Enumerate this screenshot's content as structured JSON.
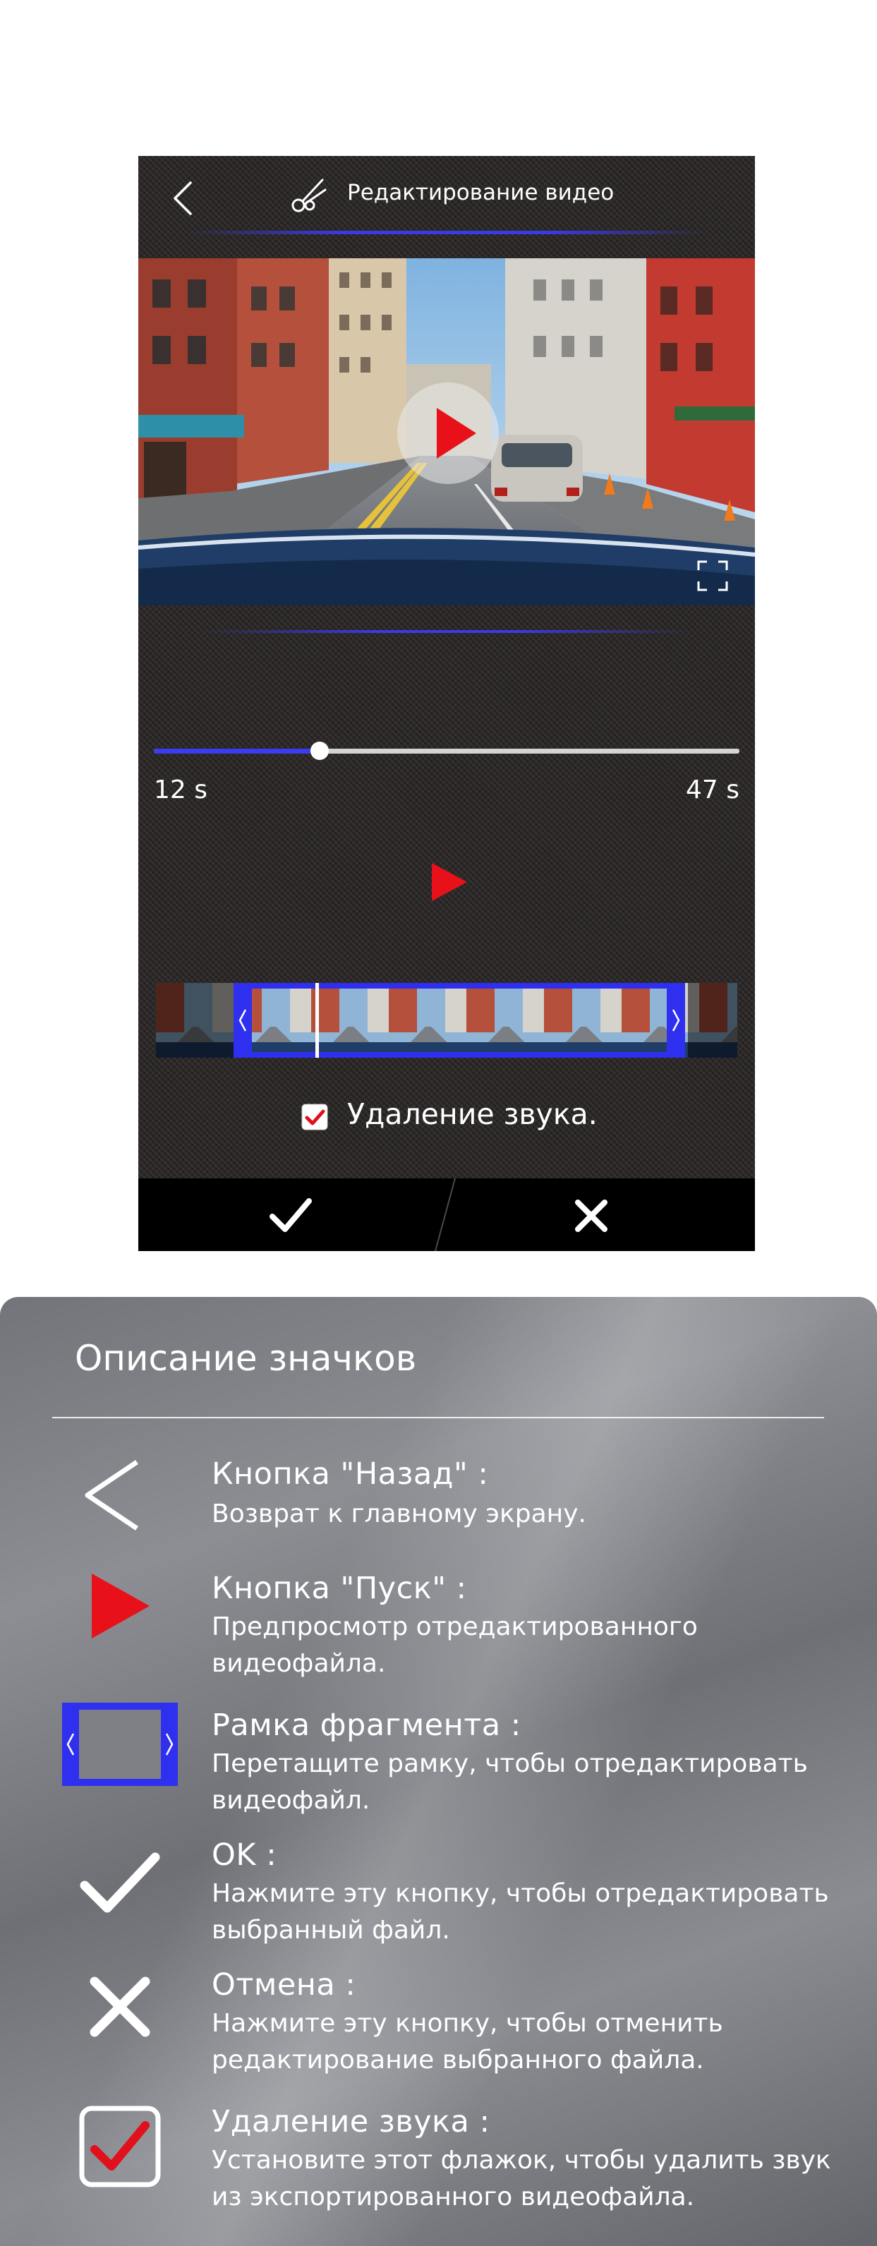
{
  "header": {
    "title": "Редактирование видео"
  },
  "playback": {
    "start_time": "12 s",
    "end_time": "47 s",
    "progress": 0.28
  },
  "mute": {
    "label": "Удаление звука.",
    "checked": true
  },
  "legend": {
    "title": "Описание значков",
    "items": [
      {
        "icon": "back-chevron-icon",
        "title": "Кнопка \"Назад\" :",
        "desc": "Возврат к главному экрану."
      },
      {
        "icon": "play-triangle-icon",
        "title": "Кнопка \"Пуск\" :",
        "desc": "Предпросмотр отредактированного видеофайла."
      },
      {
        "icon": "fragment-frame-icon",
        "title": "Рамка фрагмента :",
        "desc": "Перетащите рамку, чтобы отредактировать видеофайл."
      },
      {
        "icon": "checkmark-icon",
        "title": "OK :",
        "desc": "Нажмите эту кнопку, чтобы отредактировать выбранный файл."
      },
      {
        "icon": "cross-icon",
        "title": "Отмена :",
        "desc": "Нажмите эту кнопку, чтобы отменить редактирование выбранного файла."
      },
      {
        "icon": "checked-checkbox-icon",
        "title": "Удаление звука :",
        "desc": "Установите этот флажок, чтобы удалить звук из экспортированного видеофайла."
      }
    ]
  },
  "colors": {
    "accent_blue": "#2f2ff0",
    "play_red": "#e8111a",
    "check_red": "#e0101d"
  }
}
